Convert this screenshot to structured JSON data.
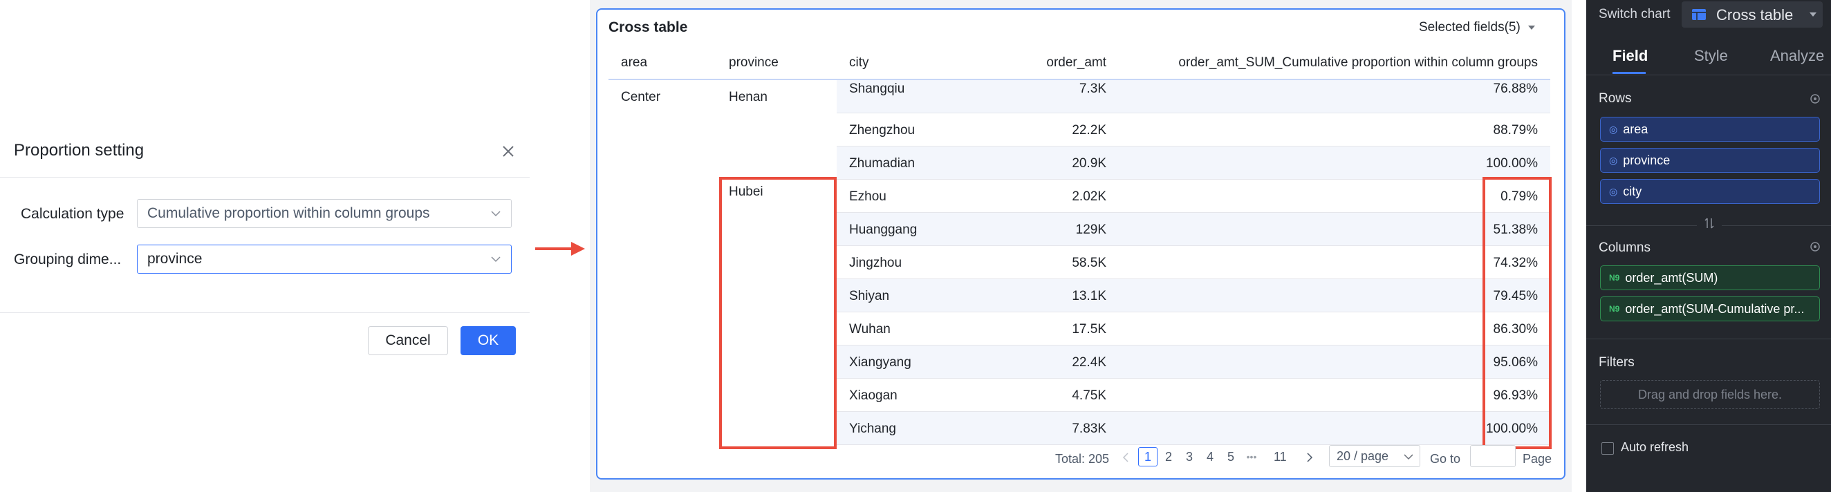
{
  "dialog": {
    "title": "Proportion setting",
    "calc_type_label": "Calculation type",
    "calc_type_value": "Cumulative proportion within column groups",
    "grouping_label": "Grouping dime...",
    "grouping_value": "province",
    "cancel_label": "Cancel",
    "ok_label": "OK"
  },
  "table": {
    "title": "Cross table",
    "selected_fields": "Selected fields(5)",
    "headers": {
      "area": "area",
      "province": "province",
      "city": "city",
      "order_amt": "order_amt",
      "proportion": "order_amt_SUM_Cumulative proportion within column groups"
    },
    "area": "Center",
    "provinces": [
      "Henan",
      "Hubei"
    ],
    "rows": [
      {
        "city": "Shangqiu",
        "amt": "7.3K",
        "pct": "76.88%"
      },
      {
        "city": "Zhengzhou",
        "amt": "22.2K",
        "pct": "88.79%"
      },
      {
        "city": "Zhumadian",
        "amt": "20.9K",
        "pct": "100.00%"
      },
      {
        "city": "Ezhou",
        "amt": "2.02K",
        "pct": "0.79%"
      },
      {
        "city": "Huanggang",
        "amt": "129K",
        "pct": "51.38%"
      },
      {
        "city": "Jingzhou",
        "amt": "58.5K",
        "pct": "74.32%"
      },
      {
        "city": "Shiyan",
        "amt": "13.1K",
        "pct": "79.45%"
      },
      {
        "city": "Wuhan",
        "amt": "17.5K",
        "pct": "86.30%"
      },
      {
        "city": "Xiangyang",
        "amt": "22.4K",
        "pct": "95.06%"
      },
      {
        "city": "Xiaogan",
        "amt": "4.75K",
        "pct": "96.93%"
      },
      {
        "city": "Yichang",
        "amt": "7.83K",
        "pct": "100.00%"
      }
    ],
    "pagination": {
      "total": "Total: 205",
      "pages": [
        "1",
        "2",
        "3",
        "4",
        "5"
      ],
      "ellipsis": "•••",
      "last": "11",
      "page_size": "20 / page",
      "goto": "Go to",
      "page": "Page"
    }
  },
  "sidebar": {
    "switch_label": "Switch chart",
    "chart_type": "Cross table",
    "tabs": [
      "Field",
      "Style",
      "Analyze"
    ],
    "rows_title": "Rows",
    "row_fields": [
      "area",
      "province",
      "city"
    ],
    "columns_title": "Columns",
    "column_fields": [
      "order_amt(SUM)",
      "order_amt(SUM-Cumulative pr..."
    ],
    "measure_badge": "N9",
    "filters_title": "Filters",
    "filters_placeholder": "Drag and drop fields here.",
    "auto_refresh": "Auto refresh"
  },
  "colors": {
    "accent": "#2f6df6",
    "highlight_red": "#ea4c3d",
    "sidebar_bg": "#24272d"
  }
}
